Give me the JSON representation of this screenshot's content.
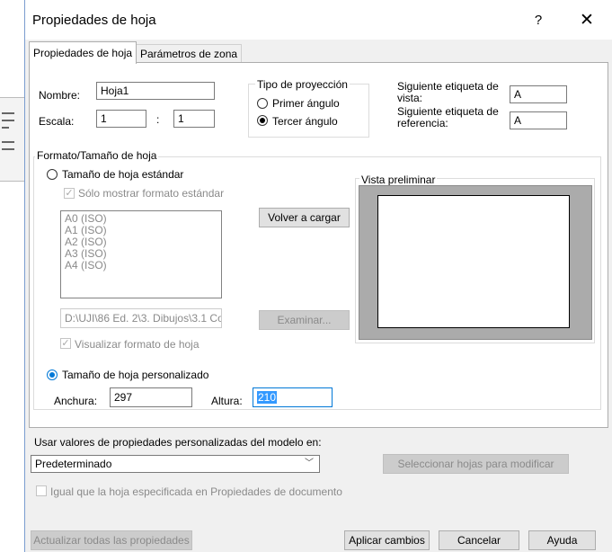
{
  "dialog": {
    "title": "Propiedades de hoja",
    "help_icon": "?",
    "close_icon": "✕"
  },
  "tabs": [
    {
      "label": "Propiedades de hoja",
      "active": true
    },
    {
      "label": "Parámetros de zona",
      "active": false
    }
  ],
  "sheet": {
    "name_label": "Nombre:",
    "name_value": "Hoja1",
    "scale_label": "Escala:",
    "scale_num": "1",
    "scale_sep": ":",
    "scale_den": "1"
  },
  "projection": {
    "title": "Tipo de proyección",
    "options": [
      {
        "label": "Primer ángulo",
        "selected": false
      },
      {
        "label": "Tercer ángulo",
        "selected": true
      }
    ]
  },
  "labels": {
    "next_view_label": "Siguiente etiqueta de vista:",
    "next_view_value": "A",
    "next_ref_label": "Siguiente etiqueta de referencia:",
    "next_ref_value": "A"
  },
  "format": {
    "group_title": "Formato/Tamaño de hoja",
    "standard_radio": "Tamaño de hoja estándar",
    "standard_selected": false,
    "only_standard_label": "Sólo mostrar formato estándar",
    "sizes": [
      "A0 (ISO)",
      "A1 (ISO)",
      "A2 (ISO)",
      "A3 (ISO)",
      "A4 (ISO)"
    ],
    "reload_button": "Volver a cargar",
    "path_value": "D:\\UJI\\86 Ed. 2\\3. Dibujos\\3.1 Co",
    "browse_button": "Examinar...",
    "show_format_label": "Visualizar formato de hoja",
    "preview_title": "Vista preliminar",
    "custom_radio": "Tamaño de hoja personalizado",
    "custom_selected": true,
    "width_label": "Anchura:",
    "width_value": "297",
    "height_label": "Altura:",
    "height_value": "210"
  },
  "model": {
    "label": "Usar valores de propiedades personalizadas del modelo en:",
    "combo_value": "Predeterminado",
    "select_sheets_button": "Seleccionar hojas para modificar",
    "same_as_label": "Igual que la hoja especificada en Propiedades de documento"
  },
  "footer": {
    "update_all": "Actualizar todas las propiedades",
    "apply": "Aplicar cambios",
    "cancel": "Cancelar",
    "help": "Ayuda"
  },
  "colors": {
    "accent": "#0078d7",
    "selection": "#3399ff",
    "dialog_bg": "#f0f0f0"
  }
}
